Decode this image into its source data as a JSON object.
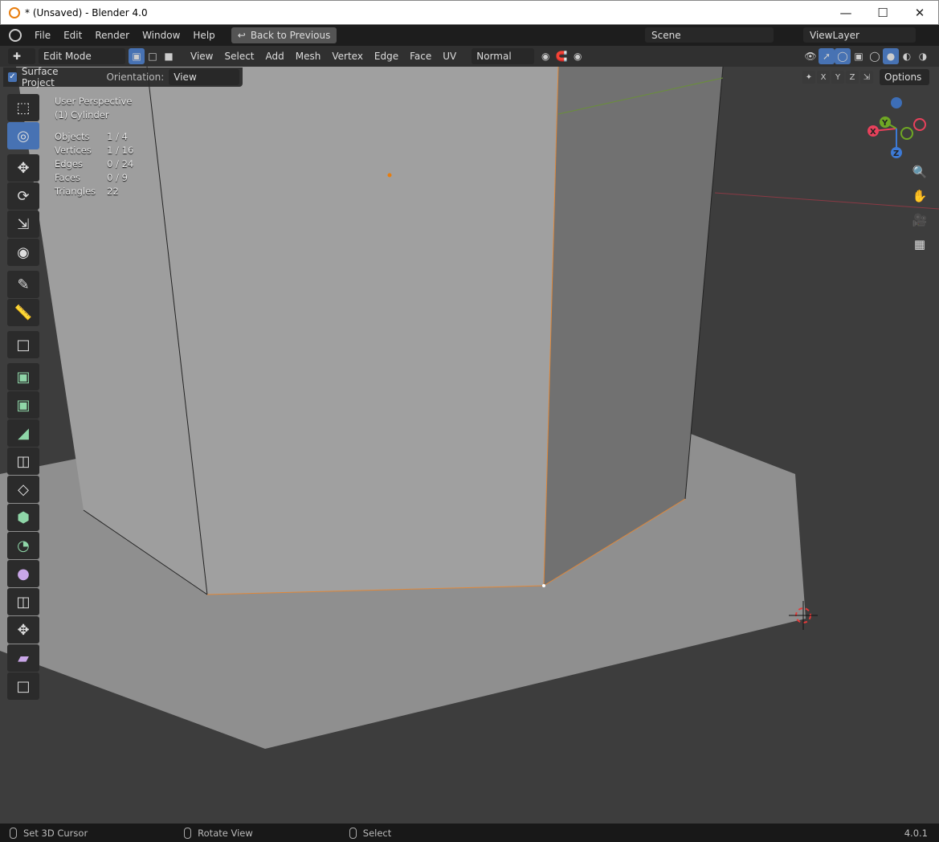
{
  "window": {
    "title": "* (Unsaved) - Blender 4.0",
    "controls": [
      "minimize",
      "maximize",
      "close"
    ]
  },
  "menubar": {
    "items": [
      "File",
      "Edit",
      "Render",
      "Window",
      "Help"
    ],
    "back_button": "Back to Previous",
    "scene": "Scene",
    "view_layer": "ViewLayer"
  },
  "header": {
    "mode": "Edit Mode",
    "menus": [
      "View",
      "Select",
      "Add",
      "Mesh",
      "Vertex",
      "Edge",
      "Face",
      "UV"
    ],
    "transform_orientation": "Normal",
    "options_label": "Options",
    "axes": [
      "X",
      "Y",
      "Z"
    ]
  },
  "tool_options": {
    "surface_project_label": "Surface Project",
    "surface_project_checked": true,
    "orientation_label": "Orientation:",
    "orientation_value": "View"
  },
  "overlay": {
    "perspective": "User Perspective",
    "object": "(1) Cylinder",
    "stats": [
      {
        "label": "Objects",
        "value": "1 / 4"
      },
      {
        "label": "Vertices",
        "value": "1 / 16"
      },
      {
        "label": "Edges",
        "value": "0 / 24"
      },
      {
        "label": "Faces",
        "value": "0 / 9"
      },
      {
        "label": "Triangles",
        "value": "22"
      }
    ]
  },
  "toolbar": {
    "tools": [
      "select-box",
      "cursor",
      "move",
      "rotate",
      "scale",
      "transform",
      "annotate",
      "measure",
      "add-cube",
      "extrude",
      "inset",
      "bevel",
      "loop-cut",
      "knife",
      "poly-build",
      "spin",
      "smooth",
      "edge-slide",
      "shrink-fatten",
      "shear",
      "rip-region"
    ],
    "active": "cursor"
  },
  "gizmo": {
    "axes": {
      "x_color": "#e8415b",
      "y_color": "#6fa724",
      "z_color": "#3d7ad6"
    },
    "labels": [
      "X",
      "Y",
      "Z"
    ]
  },
  "statusbar": {
    "items": [
      "Set 3D Cursor",
      "Rotate View",
      "Select"
    ],
    "version": "4.0.1"
  }
}
